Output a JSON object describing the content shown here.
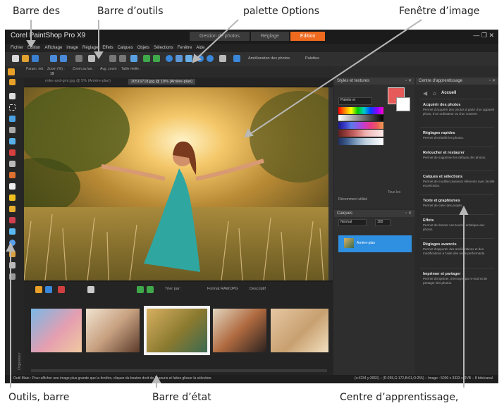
{
  "annotations": {
    "top": [
      "Barre des",
      "Barre d’outils",
      "palette Options",
      "Fenêtre d’image"
    ],
    "bottom": [
      "Outils, barre",
      "Barre d’état",
      "Centre d’apprentissage,"
    ]
  },
  "app": {
    "title": "Corel PaintShop Pro X9",
    "workspace_tabs": [
      "Gestion de photos",
      "Réglage",
      "Édition"
    ],
    "active_workspace": "Édition",
    "window_controls": "— ❐ ✕",
    "menus": [
      "Fichier",
      "Édition",
      "Affichage",
      "Image",
      "Réglage",
      "Effets",
      "Calques",
      "Objets",
      "Sélections",
      "Fenêtre",
      "Aide"
    ],
    "toolbar": {
      "enhance_label": "Amélioration des photos",
      "palettes_label": "Palettes"
    },
    "options": {
      "labels": [
        "Param. init :",
        "Zoom (%) :",
        "Zoom av./arr. :",
        "Avg. zoom :",
        "Taille réelle :"
      ],
      "zoom_value": "19"
    },
    "doc_tabs": [
      "mike-and-gmr.jpg @ 5% (Arrière-plan)",
      "20516718.jpg @ 19% (Arrière-plan)"
    ],
    "organizer": {
      "sort_label": "Trier par :",
      "filter_label": "Format RAW/JPG",
      "desc_label": "Descriptif",
      "side_label": "Organiseur"
    },
    "styles_panel": {
      "title": "Styles et textures",
      "palette_name": "Palette et",
      "recent_label": "Récemment utilisé",
      "all_label": "Tous les"
    },
    "layers_panel": {
      "title": "Calques",
      "blend_mode": "Normal",
      "opacity": "100",
      "layer_name": "Arrière-plan"
    },
    "learning_center": {
      "title": "Centre d’apprentissage",
      "home": "Accueil",
      "sections": [
        {
          "heading": "Acquérir des photos",
          "desc": "Permet d’acquérir des photos à partir d’un appareil photo, d’un ordinateur ou d’un scanner."
        },
        {
          "heading": "Réglages rapides",
          "desc": "Permet d’embellir les photos."
        },
        {
          "heading": "Retoucher et restaurer",
          "desc": "Permet de supprimer les défauts des photos."
        },
        {
          "heading": "Calques et sélections",
          "desc": "Permet de modifier plusieurs éléments avec facilité et précision."
        },
        {
          "heading": "Texte et graphismes",
          "desc": "Permet de créer des projets."
        },
        {
          "heading": "Effets",
          "desc": "Permet de donner une touche artistique aux photos."
        },
        {
          "heading": "Réglages avancés",
          "desc": "Permet d’apporter des améliorations et des modifications à l’aide des outils performants."
        },
        {
          "heading": "Imprimer et partager",
          "desc": "Permet d’imprimer, d’envoyer par e-mail et de partager des photos."
        }
      ]
    },
    "status": {
      "hint": "Outil Main : Pour afficher une image plus grande que la fenêtre, cliquez du bouton droit de la souris et faites glisser la sélection.",
      "coords": "(x:4234 y:3063) – (R:255,G:172,B:61,O:255) – Image : 5000 x 3333 x RVB – 8 bits/canal"
    }
  },
  "colors": {
    "accent": "#ee6a1e",
    "selection": "#2f8fe0"
  }
}
